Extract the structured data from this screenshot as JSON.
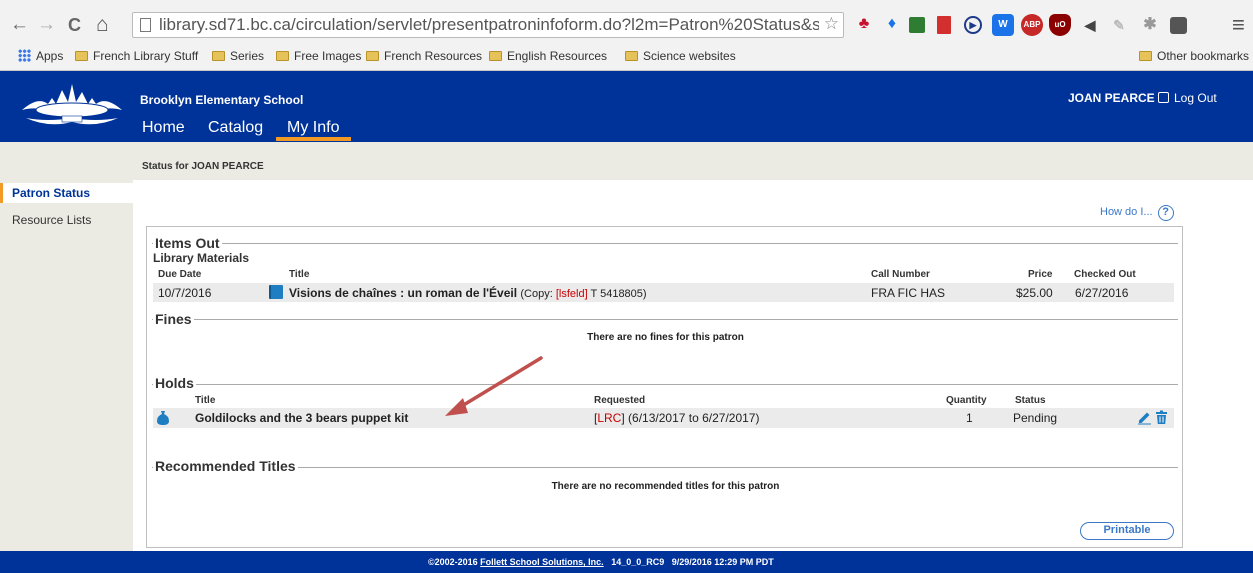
{
  "browser": {
    "nav": {
      "back": "←",
      "forward": "→",
      "reload": "C",
      "home": "⌂"
    },
    "url": "library.sd71.bc.ca/circulation/servlet/presentpatroninfoform.do?l2m=Patron%20Status&sideLir",
    "star": "☆",
    "menu": "≡",
    "bookmarks": [
      "Apps",
      "French Library Stuff",
      "Series",
      "Free Images",
      "French Resources",
      "English Resources",
      "Science websites"
    ],
    "other_bookmarks": "Other bookmarks"
  },
  "header": {
    "school": "Brooklyn Elementary School",
    "logo_text": "Brooklyn School",
    "tabs": [
      "Home",
      "Catalog",
      "My Info"
    ],
    "active_tab": "My Info",
    "user": "JOAN PEARCE",
    "logout": "Log Out",
    "accent": "#003399",
    "active_tab_color": "#f29a24"
  },
  "status_heading": "Status for JOAN PEARCE",
  "sidebar": {
    "items": [
      {
        "label": "Patron Status",
        "active": true
      },
      {
        "label": "Resource Lists",
        "active": false
      }
    ]
  },
  "help": {
    "label": "How do I...",
    "icon": "question-icon"
  },
  "items_out": {
    "title": "Items Out",
    "subtitle": "Library Materials",
    "columns": [
      "Due Date",
      "Title",
      "Call Number",
      "Price",
      "Checked Out"
    ],
    "rows": [
      {
        "due": "10/7/2016",
        "icon": "book-icon",
        "title": "Visions de chaînes : un roman de l'Éveil",
        "copy_prefix": "(Copy: ",
        "copy_loc": "[lsfeld]",
        "copy_suffix": " T 5418805)",
        "call": "FRA FIC HAS",
        "price": "$25.00",
        "checked_out": "6/27/2016"
      }
    ]
  },
  "fines": {
    "title": "Fines",
    "message": "There are no fines for this patron"
  },
  "holds": {
    "title": "Holds",
    "columns": [
      "Title",
      "Requested",
      "Quantity",
      "Status"
    ],
    "rows": [
      {
        "icon": "kit-bag-icon",
        "title": "Goldilocks and the 3 bears puppet kit",
        "loc": "LRC",
        "requested": " (6/13/2017 to 6/27/2017)",
        "quantity": "1",
        "status": "Pending"
      }
    ]
  },
  "recommended": {
    "title": "Recommended Titles",
    "message": "There are no recommended titles for this patron"
  },
  "printable": "Printable",
  "footer": {
    "copyright": "©2002-2016 ",
    "company": "Follett School Solutions, Inc.",
    "version": "14_0_0_RC9",
    "timestamp": "9/29/2016 12:29 PM PDT"
  }
}
